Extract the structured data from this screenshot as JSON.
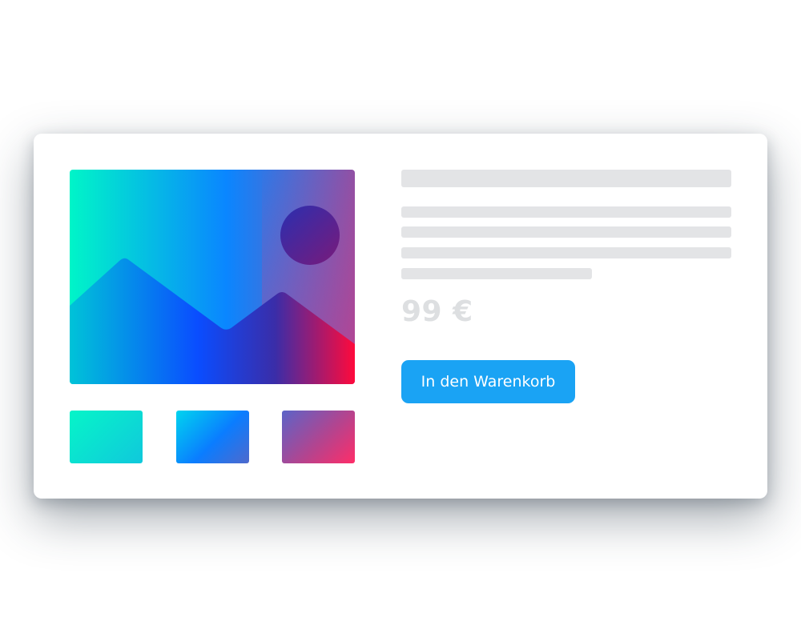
{
  "product": {
    "price": "99 €",
    "cart_button_label": "In den Warenkorb"
  },
  "colors": {
    "button": "#1aa3f4",
    "skeleton": "#e3e4e6",
    "price_text": "#dddfe1",
    "image_gradient": [
      "#00f5c8",
      "#0a7dff",
      "#7a5fb6",
      "#ff2d55"
    ]
  },
  "gallery": {
    "main_image_icon": "image-placeholder-icon",
    "thumbnail_count": 3
  }
}
